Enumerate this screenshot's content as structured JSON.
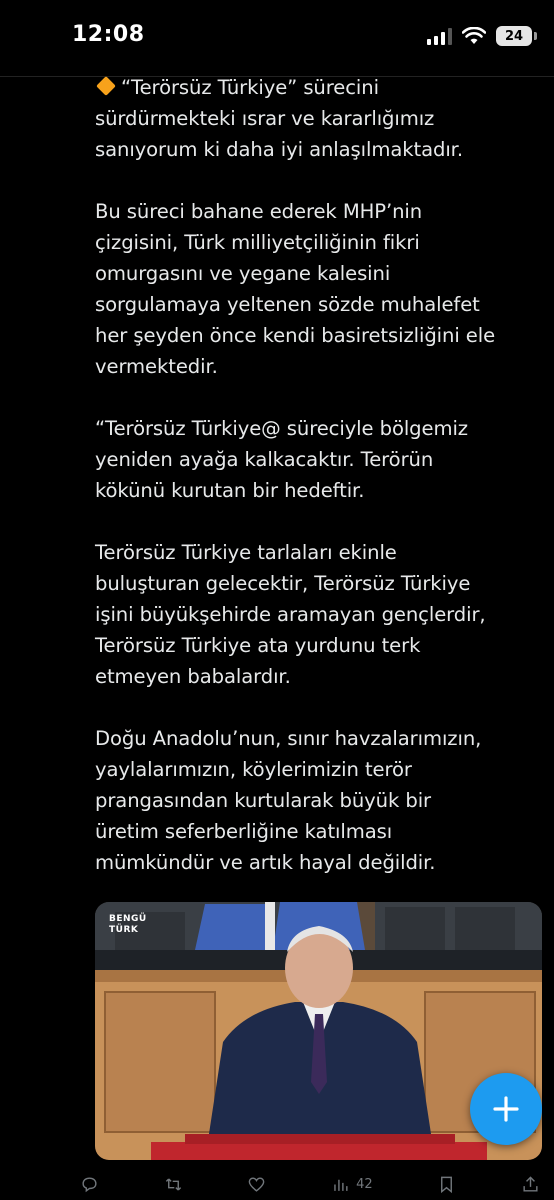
{
  "status_bar": {
    "time": "12:08",
    "battery": "24",
    "icons": [
      "cellular-signal-icon",
      "wifi-icon",
      "battery-icon"
    ]
  },
  "tweet": {
    "paragraphs": [
      {
        "icon": "orange-diamond-icon",
        "lines": [
          "“Terörsüz Türkiye” sürecini",
          "sürdürmekteki ısrar ve kararlığımız",
          "sanıyorum ki daha iyi anlaşılmaktadır."
        ]
      },
      {
        "lines": [
          "Bu süreci bahane ederek MHP’nin",
          "çizgisini, Türk milliyetçiliğinin fikri",
          "omurgasını ve yegane kalesini",
          "sorgulamaya yeltenen sözde muhalefet",
          "her şeyden önce kendi basiretsizliğini ele",
          "vermektedir."
        ]
      },
      {
        "lines": [
          "“Terörsüz Türkiye@ süreciyle bölgemiz",
          "yeniden ayağa kalkacaktır. Terörün",
          "kökünü kurutan bir hedeftir."
        ]
      },
      {
        "lines": [
          "Terörsüz Türkiye tarlaları ekinle",
          "buluşturan gelecektir, Terörsüz Türkiye",
          "işini büyükşehirde aramayan gençlerdir,",
          "Terörsüz Türkiye ata yurdunu terk",
          "etmeyen babalardır."
        ]
      },
      {
        "lines": [
          "Doğu Anadolu’nun, sınır havzalarımızın,",
          "yaylalarımızın, köylerimizin terör",
          "prangasından kurtularak büyük bir",
          "üretim seferberliğine katılması",
          "mümkündür ve artık hayal değildir."
        ]
      }
    ],
    "media": {
      "channel_logo_line1": "BENGÜ",
      "channel_logo_line2": "TÜRK"
    }
  },
  "actions": {
    "reply": {
      "icon": "reply-icon"
    },
    "repost": {
      "icon": "repost-icon"
    },
    "like": {
      "icon": "like-icon"
    },
    "views": {
      "icon": "views-icon",
      "count": "42"
    },
    "bookmark": {
      "icon": "bookmark-icon"
    },
    "share": {
      "icon": "share-icon"
    }
  },
  "fab": {
    "icon": "plus-icon"
  },
  "colors": {
    "background": "#000000",
    "text": "#e7e9ea",
    "muted": "#71767b",
    "accent": "#1d9bf0",
    "emoji_orange": "#f7a21b"
  }
}
